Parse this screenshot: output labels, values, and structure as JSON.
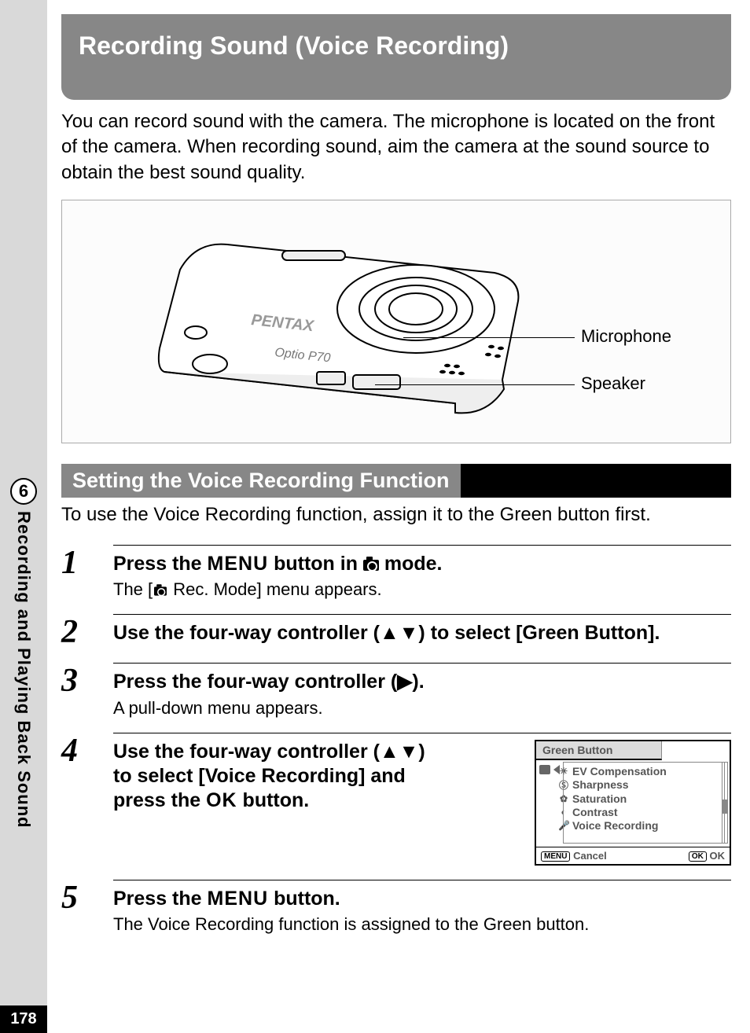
{
  "sidebar": {
    "chapter_number": "6",
    "chapter_title": "Recording and Playing Back Sound",
    "page_number": "178"
  },
  "title": "Recording Sound (Voice Recording)",
  "intro": "You can record sound with the camera. The microphone is located on the front of the camera. When recording sound, aim the camera at the sound source to obtain the best sound quality.",
  "diagram": {
    "brand_text": "PENTAX",
    "model_text": "Optio P70",
    "callout1": "Microphone",
    "callout2": "Speaker"
  },
  "subheader": "Setting the Voice Recording Function",
  "sub_intro": "To use the Voice Recording function, assign it to the Green button first.",
  "steps": {
    "s1": {
      "num": "1",
      "title_pre": "Press the ",
      "kw1": "MENU",
      "title_mid": " button in ",
      "title_post": " mode.",
      "desc_pre": "The [",
      "desc_post": " Rec. Mode] menu appears."
    },
    "s2": {
      "num": "2",
      "title": "Use the four-way controller (▲▼) to select [Green Button]."
    },
    "s3": {
      "num": "3",
      "title": "Press the four-way controller (▶).",
      "desc": "A pull-down menu appears."
    },
    "s4": {
      "num": "4",
      "title_l1": "Use the four-way controller (▲▼)",
      "title_l2": "to select [Voice Recording] and",
      "title_l3_pre": "press the ",
      "kw1": "OK",
      "title_l3_post": " button."
    },
    "s5": {
      "num": "5",
      "title_pre": "Press the ",
      "kw1": "MENU",
      "title_post": " button.",
      "desc": "The Voice Recording function is assigned to the Green button."
    }
  },
  "lcd": {
    "title": "Green Button",
    "items": {
      "i0": "EV Compensation",
      "i1": "Sharpness",
      "i2": "Saturation",
      "i3": "Contrast",
      "i4": "Voice Recording"
    },
    "footer_left_badge": "MENU",
    "footer_left": "Cancel",
    "footer_right_badge": "OK",
    "footer_right": "OK"
  }
}
